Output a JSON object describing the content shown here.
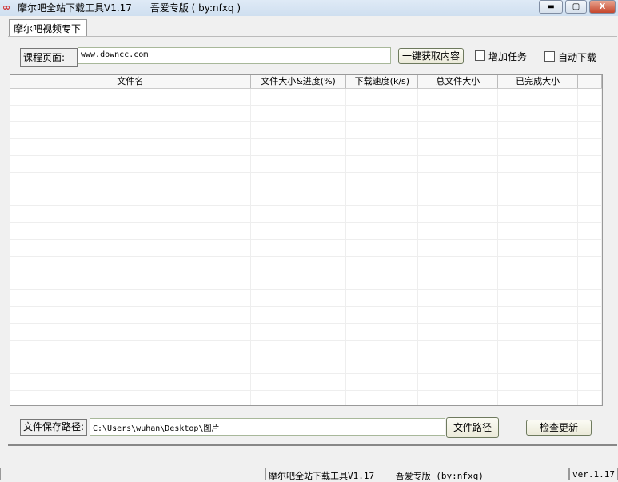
{
  "window": {
    "title": "摩尔吧全站下载工具V1.17      吾爱专版 ( by:nfxq )",
    "logo": "∞",
    "min": "▬",
    "max": "▢",
    "close": "X"
  },
  "tab": "摩尔吧视频专下",
  "course": {
    "label": "课程页面:",
    "value": "www.downcc.com",
    "fetch": "一键获取内容",
    "add_task": "增加任务",
    "auto_download": "自动下载"
  },
  "table": {
    "columns": [
      "文件名",
      "文件大小&进度(%)",
      "下载速度(k/s)",
      "总文件大小",
      "已完成大小",
      ""
    ]
  },
  "save": {
    "label": "文件保存路径:",
    "value": "C:\\Users\\wuhan\\Desktop\\图片",
    "browse": "文件路径",
    "update": "检查更新"
  },
  "status": {
    "center": "摩尔吧全站下载工具V1.17    吾爱专版 (by:nfxq)",
    "version": "ver.1.17"
  }
}
